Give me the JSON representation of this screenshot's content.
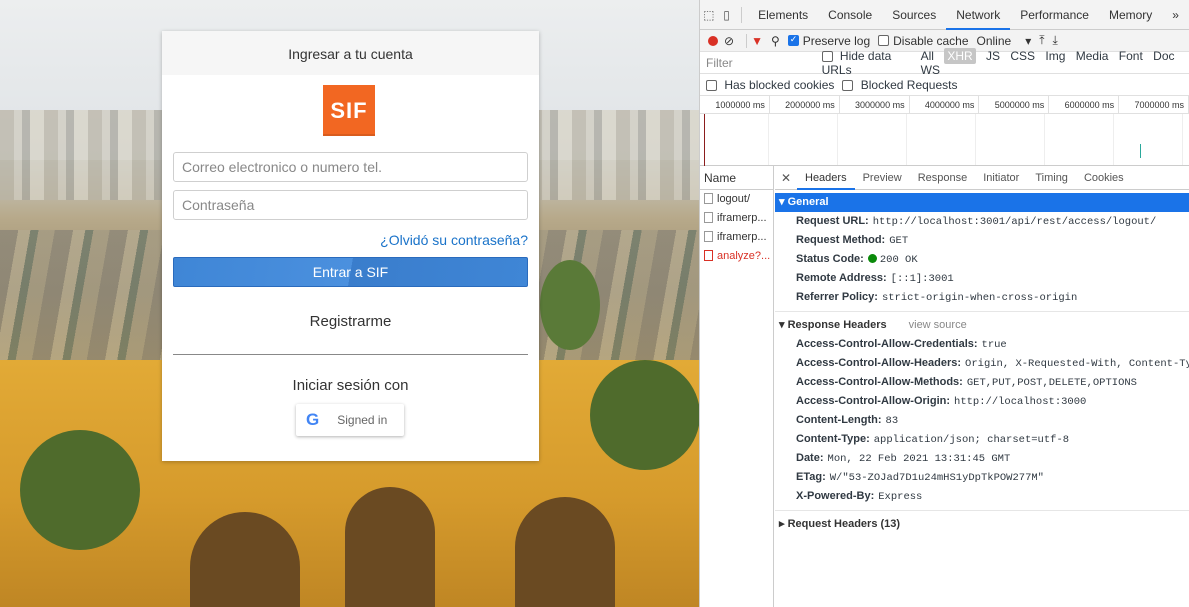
{
  "login": {
    "header_title": "Ingresar a tu cuenta",
    "logo_text": "SIF",
    "email_placeholder": "Correo electronico o numero tel.",
    "password_placeholder": "Contraseña",
    "forgot_link": "¿Olvidó su contraseña?",
    "submit_label": "Entrar a SIF",
    "register_label": "Registrarme",
    "alt_login_label": "Iniciar sesión con",
    "google_button_label": "Signed in",
    "colors": {
      "logo_bg": "#f26722",
      "submit_bg": "#4188d8",
      "link": "#1a73c9"
    }
  },
  "devtools": {
    "tabs": [
      "Elements",
      "Console",
      "Sources",
      "Network",
      "Performance",
      "Memory"
    ],
    "active_tab": "Network",
    "more_tabs": "»",
    "toolbar": {
      "preserve_log": "Preserve log",
      "disable_cache": "Disable cache",
      "throttling": "Online"
    },
    "filter": {
      "placeholder": "Filter",
      "hide_data_urls": "Hide data URLs",
      "types": [
        "All",
        "XHR",
        "JS",
        "CSS",
        "Img",
        "Media",
        "Font",
        "Doc",
        "WS"
      ],
      "active_type": "XHR",
      "has_blocked_cookies": "Has blocked cookies",
      "blocked_requests": "Blocked Requests"
    },
    "timeline_ticks": [
      "1000000 ms",
      "2000000 ms",
      "3000000 ms",
      "4000000 ms",
      "5000000 ms",
      "6000000 ms",
      "7000000 ms"
    ],
    "requests": {
      "header": "Name",
      "items": [
        {
          "name": "logout/",
          "status": "ok"
        },
        {
          "name": "iframerp...",
          "status": "ok"
        },
        {
          "name": "iframerp...",
          "status": "ok"
        },
        {
          "name": "analyze?...",
          "status": "error"
        }
      ]
    },
    "detail_tabs": [
      "Headers",
      "Preview",
      "Response",
      "Initiator",
      "Timing",
      "Cookies"
    ],
    "active_detail_tab": "Headers",
    "general": {
      "title": "▾ General",
      "fields": [
        {
          "k": "Request URL:",
          "v": "http://localhost:3001/api/rest/access/logout/"
        },
        {
          "k": "Request Method:",
          "v": "GET"
        },
        {
          "k": "Status Code:",
          "v": "200 OK"
        },
        {
          "k": "Remote Address:",
          "v": "[::1]:3001"
        },
        {
          "k": "Referrer Policy:",
          "v": "strict-origin-when-cross-origin"
        }
      ]
    },
    "response_headers": {
      "title": "▾ Response Headers",
      "view_source": "view source",
      "fields": [
        {
          "k": "Access-Control-Allow-Credentials:",
          "v": "true"
        },
        {
          "k": "Access-Control-Allow-Headers:",
          "v": "Origin, X-Requested-With, Content-Type,"
        },
        {
          "k": "Access-Control-Allow-Methods:",
          "v": "GET,PUT,POST,DELETE,OPTIONS"
        },
        {
          "k": "Access-Control-Allow-Origin:",
          "v": "http://localhost:3000"
        },
        {
          "k": "Content-Length:",
          "v": "83"
        },
        {
          "k": "Content-Type:",
          "v": "application/json; charset=utf-8"
        },
        {
          "k": "Date:",
          "v": "Mon, 22 Feb 2021 13:31:45 GMT"
        },
        {
          "k": "ETag:",
          "v": "W/\"53-ZOJad7D1u24mHS1yDpTkPOW277M\""
        },
        {
          "k": "X-Powered-By:",
          "v": "Express"
        }
      ]
    },
    "request_headers": {
      "title": "▸ Request Headers (13)"
    }
  }
}
